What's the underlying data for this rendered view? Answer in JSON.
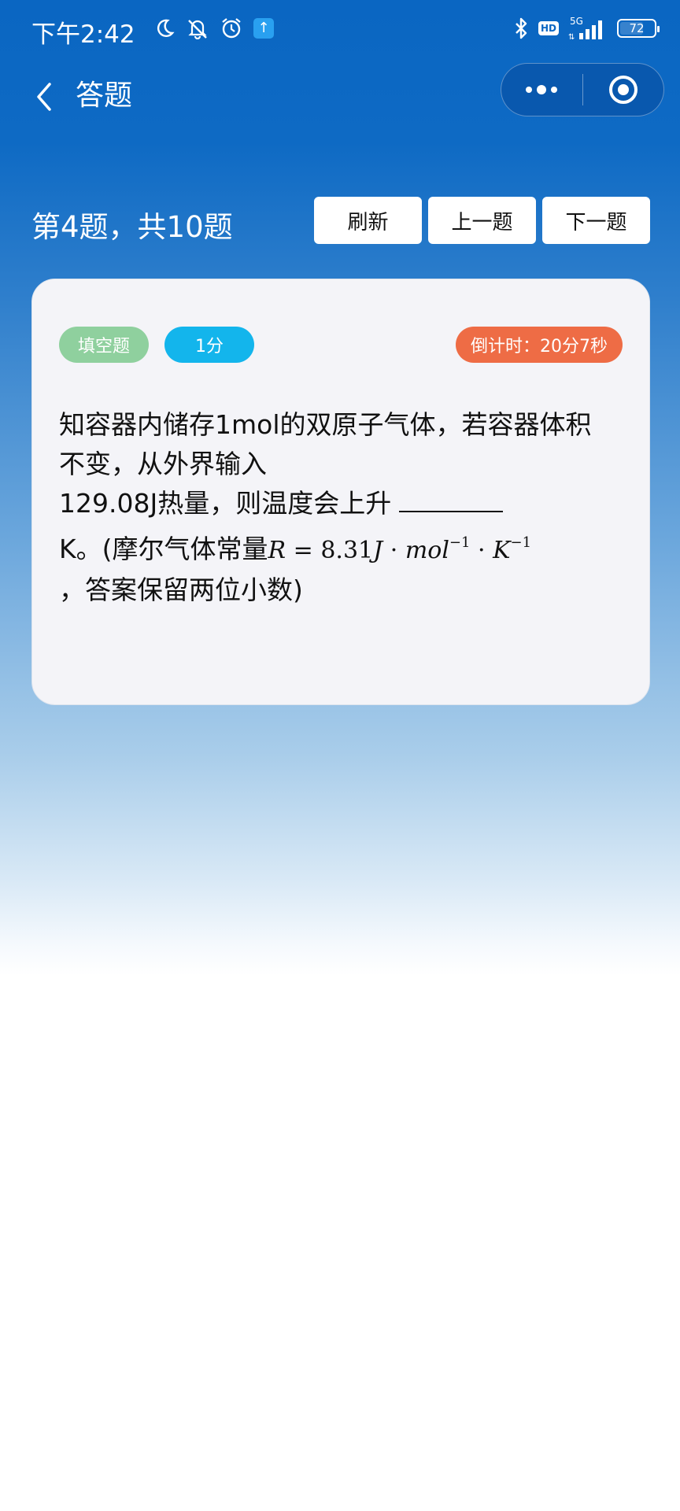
{
  "status_bar": {
    "time": "下午2:42",
    "network": "5G",
    "hd": "HD",
    "battery_level": 72,
    "battery_text": "72"
  },
  "nav": {
    "title": "答题"
  },
  "question_header": {
    "progress": "第4题，共10题",
    "buttons": {
      "refresh": "刷新",
      "prev": "上一题",
      "next": "下一题"
    }
  },
  "card": {
    "tags": {
      "type": "填空题",
      "score": "1分",
      "timer": "倒计时：20分7秒"
    },
    "question": {
      "line1": "知容器内储存1mol的双原子气体，若容器体积",
      "line2": "不变，从外界输入",
      "line3": "129.08J热量，则温度会上升",
      "line4_prefix": "K。(摩尔气体常量",
      "formula": {
        "lhs": "R",
        "eq": "=",
        "value": "8.31",
        "unit1": "J",
        "dot1": "·",
        "unit2": "mol",
        "exp2": "−1",
        "dot2": "·",
        "unit3": "K",
        "exp3": "−1"
      },
      "line5": "，答案保留两位小数)"
    }
  },
  "colors": {
    "header_blue": "#0a66c2",
    "tag_type": "#8fd09e",
    "tag_score": "#13b5ec",
    "tag_timer": "#ee6c45"
  }
}
